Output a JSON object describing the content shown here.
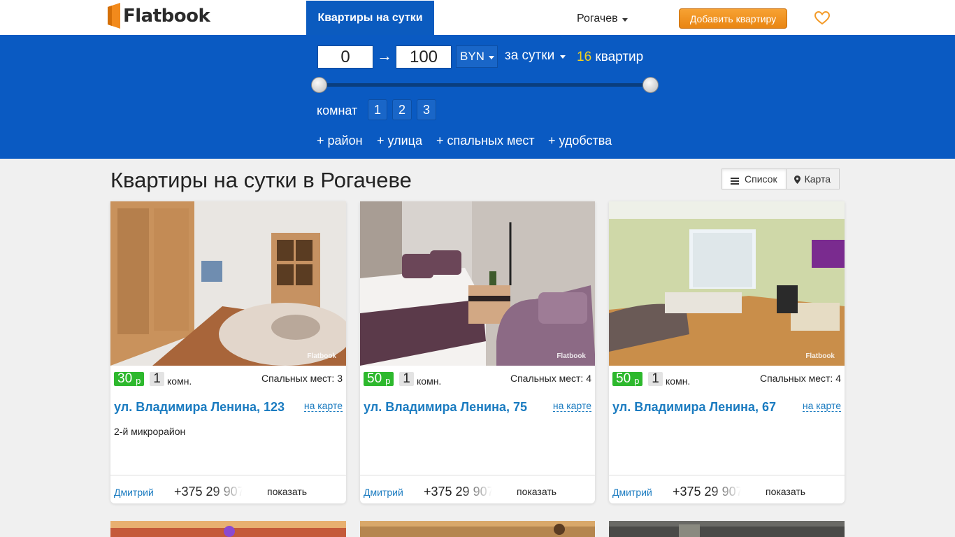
{
  "header": {
    "logo_text": "Flatbook",
    "nav_tab": "Квартиры на сутки",
    "city": "Рогачев",
    "add_button": "Добавить квартиру",
    "favorites_icon": "heart-icon"
  },
  "filters": {
    "price_min": "0",
    "price_arrow": "→",
    "price_max": "100",
    "currency": "BYN",
    "period": "за сутки",
    "count_num": "16",
    "count_label": "квартир",
    "rooms_label": "комнат",
    "rooms": [
      "1",
      "2",
      "3"
    ],
    "extras": [
      "+ район",
      "+ улица",
      "+ спальных мест",
      "+ удобства"
    ]
  },
  "main": {
    "title": "Квартиры на сутки в Рогачеве",
    "view_list": "Список",
    "view_map": "Карта",
    "listings": [
      {
        "price": "30",
        "currency": "р",
        "rooms": "1",
        "rooms_suffix": "комн.",
        "beds": "Спальных мест: 3",
        "address": "ул. Владимира Ленина, 123",
        "map_link": "на карте",
        "district": "2-й микрорайон",
        "owner": "Дмитрий",
        "phone": "+375 29 907",
        "show": "показать",
        "watermark": "Flatbook"
      },
      {
        "price": "50",
        "currency": "р",
        "rooms": "1",
        "rooms_suffix": "комн.",
        "beds": "Спальных мест: 4",
        "address": "ул. Владимира Ленина, 75",
        "map_link": "на карте",
        "district": "",
        "owner": "Дмитрий",
        "phone": "+375 29 907",
        "show": "показать",
        "watermark": "Flatbook"
      },
      {
        "price": "50",
        "currency": "р",
        "rooms": "1",
        "rooms_suffix": "комн.",
        "beds": "Спальных мест: 4",
        "address": "ул. Владимира Ленина, 67",
        "map_link": "на карте",
        "district": "",
        "owner": "Дмитрий",
        "phone": "+375 29 907",
        "show": "показать",
        "watermark": "Flatbook"
      }
    ]
  },
  "colors": {
    "brand_blue": "#0a5ac2",
    "accent_orange": "#f39a27",
    "price_green": "#2db82d",
    "link_blue": "#1a7bc0",
    "count_yellow": "#f5d21d"
  }
}
